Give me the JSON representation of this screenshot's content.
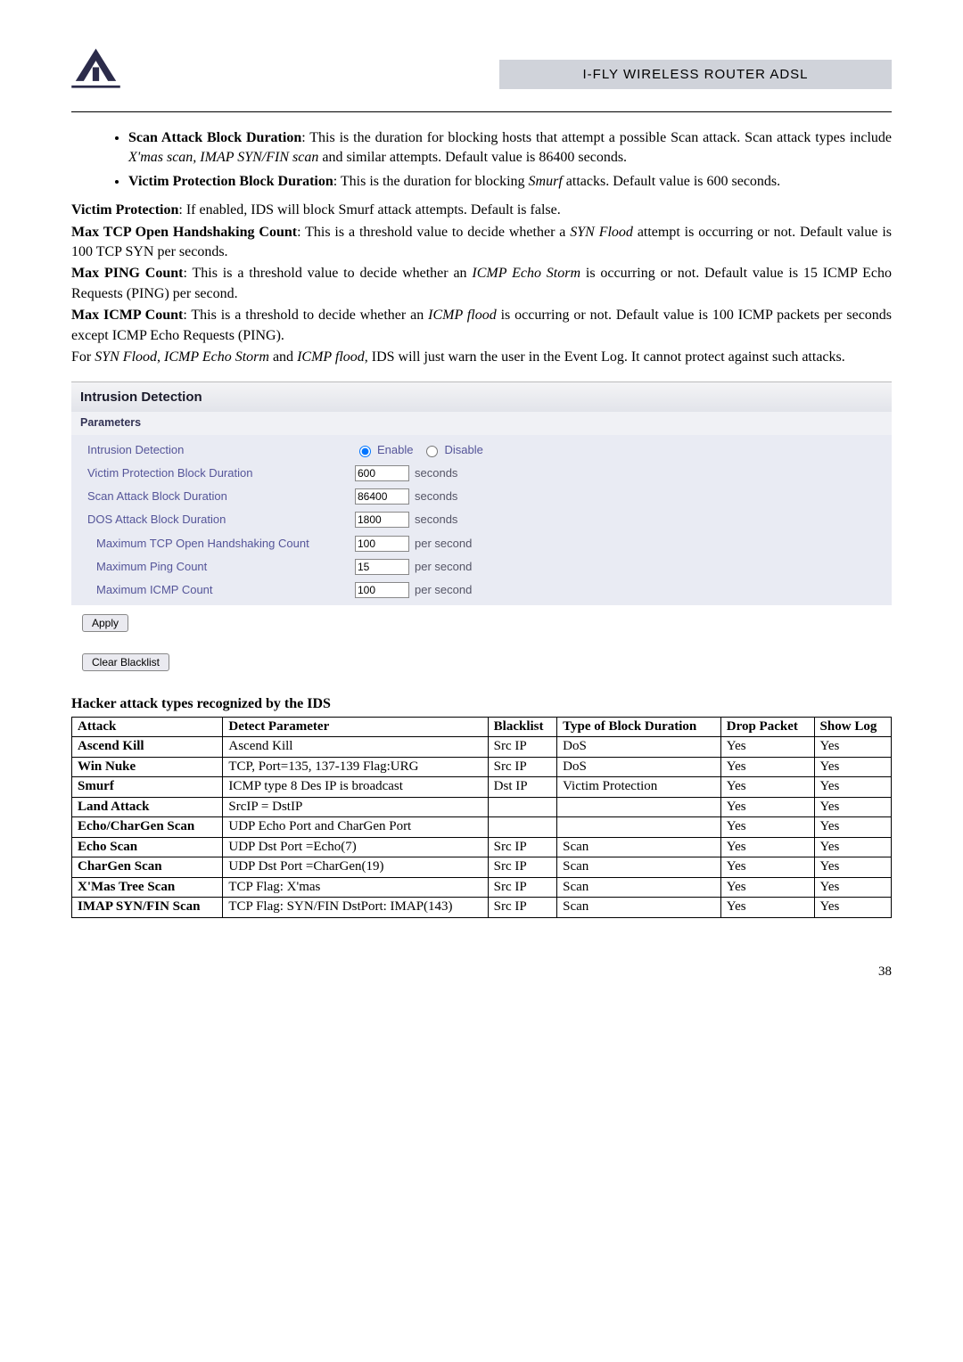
{
  "header": {
    "title": "I-FLY WIRELESS ROUTER ADSL"
  },
  "bullets": [
    {
      "bold": "Scan Attack Block Duration",
      "rest": ": This is the duration for blocking hosts that attempt a possible Scan attack. Scan attack types include ",
      "italic": "X'mas scan, IMAP SYN/FIN scan",
      "tail": " and similar attempts. Default value is 86400 seconds."
    },
    {
      "bold": "Victim Protection Block Duration",
      "rest": ": This is the duration for blocking ",
      "italic": "Smurf",
      "tail": " attacks. Default value is 600 seconds."
    }
  ],
  "paras": {
    "p1_b": "Victim Protection",
    "p1": ": If enabled, IDS will block Smurf attack attempts. Default is false.",
    "p2_b": "Max TCP Open Handshaking Count",
    "p2_a": ": This is a threshold value to decide whether a ",
    "p2_i": "SYN Flood",
    "p2_c": " attempt is occurring or not. Default value is 100 TCP SYN per seconds.",
    "p3_b": "Max PING Count",
    "p3_a": ": This is a threshold value to decide whether an ",
    "p3_i": "ICMP Echo Storm",
    "p3_c": " is occurring or not. Default value is 15 ICMP Echo Requests (PING) per second.",
    "p4_b": "Max ICMP Count",
    "p4_a": ": This is a threshold to decide whether an ",
    "p4_i": "ICMP flood",
    "p4_c": " is occurring or not. Default value is 100 ICMP packets per seconds except ICMP Echo Requests (PING).",
    "p5_a": "For ",
    "p5_i1": "SYN Flood",
    "p5_b1": ", ",
    "p5_i2": "ICMP Echo Storm",
    "p5_b2": " and ",
    "p5_i3": "ICMP flood",
    "p5_c": ", IDS will just warn the user in the Event Log. It cannot protect against such attacks."
  },
  "panel": {
    "title": "Intrusion Detection",
    "sub": "Parameters",
    "rows": [
      {
        "label": "Intrusion Detection",
        "type": "radio",
        "opt1": "Enable",
        "opt2": "Disable"
      },
      {
        "label": "Victim Protection Block Duration",
        "type": "text",
        "value": "600",
        "unit": "seconds"
      },
      {
        "label": "Scan Attack Block Duration",
        "type": "text",
        "value": "86400",
        "unit": "seconds"
      },
      {
        "label": "DOS Attack Block Duration",
        "type": "text",
        "value": "1800",
        "unit": "seconds"
      },
      {
        "label": "Maximum TCP Open Handshaking Count",
        "type": "text",
        "value": "100",
        "unit": "per second",
        "indent": true
      },
      {
        "label": "Maximum Ping Count",
        "type": "text",
        "value": "15",
        "unit": "per second",
        "indent": true
      },
      {
        "label": "Maximum ICMP Count",
        "type": "text",
        "value": "100",
        "unit": "per second",
        "indent": true
      }
    ],
    "apply": "Apply",
    "clear": "Clear Blacklist"
  },
  "attacks": {
    "heading": "Hacker attack types recognized by the IDS",
    "headers": [
      "Attack",
      "Detect Parameter",
      "Blacklist",
      "Type of Block Duration",
      "Drop Packet",
      "Show Log"
    ],
    "rows": [
      {
        "a": "Ascend Kill",
        "d": "Ascend Kill",
        "b": "Src IP",
        "t": "DoS",
        "p": "Yes",
        "l": "Yes"
      },
      {
        "a": "Win Nuke",
        "d": "TCP, Port=135, 137-139 Flag:URG",
        "b": "Src IP",
        "t": "DoS",
        "p": "Yes",
        "l": "Yes"
      },
      {
        "a": "Smurf",
        "d": "ICMP type 8 Des IP is broadcast",
        "b": "Dst IP",
        "t": "Victim Protection",
        "p": "Yes",
        "l": "Yes"
      },
      {
        "a": "Land Attack",
        "d": "SrcIP = DstIP",
        "b": "",
        "t": "",
        "p": "Yes",
        "l": "Yes"
      },
      {
        "a": "Echo/CharGen Scan",
        "d": "UDP Echo Port and CharGen Port",
        "b": "",
        "t": "",
        "p": "Yes",
        "l": "Yes"
      },
      {
        "a": "Echo Scan",
        "d": "UDP Dst Port =Echo(7)",
        "b": "Src IP",
        "t": "Scan",
        "p": "Yes",
        "l": "Yes"
      },
      {
        "a": "CharGen Scan",
        "d": "UDP Dst Port =CharGen(19)",
        "b": "Src IP",
        "t": "Scan",
        "p": "Yes",
        "l": "Yes"
      },
      {
        "a": "X'Mas Tree Scan",
        "d": "TCP Flag: X'mas",
        "b": "Src IP",
        "t": "Scan",
        "p": "Yes",
        "l": "Yes"
      },
      {
        "a": "IMAP SYN/FIN Scan",
        "d": "TCP Flag: SYN/FIN DstPort: IMAP(143)",
        "b": "Src IP",
        "t": "Scan",
        "p": "Yes",
        "l": "Yes"
      }
    ]
  },
  "pagenum": "38"
}
